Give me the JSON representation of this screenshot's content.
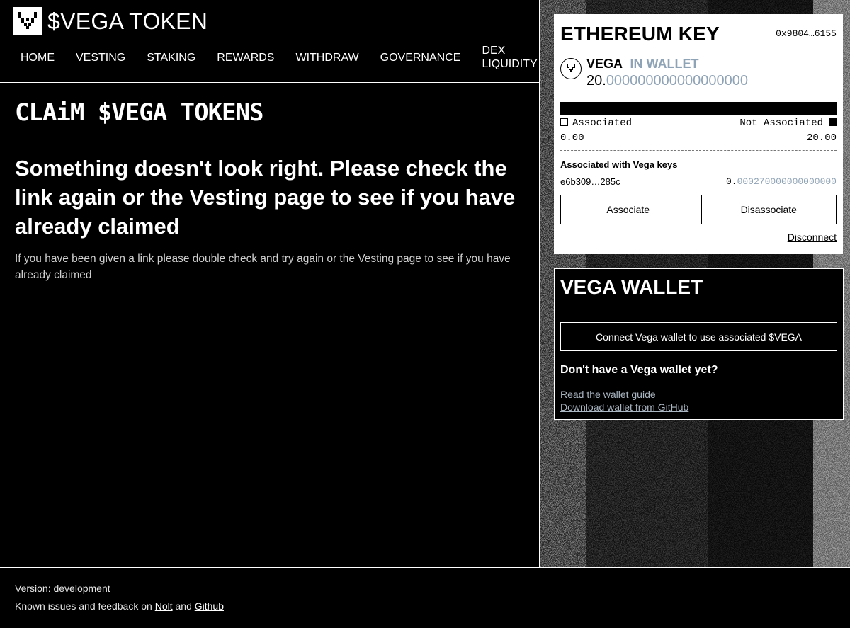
{
  "header": {
    "logo_icon": "vega-logo-icon",
    "title": "$VEGA TOKEN",
    "nav": [
      {
        "label": "HOME"
      },
      {
        "label": "VESTING"
      },
      {
        "label": "STAKING"
      },
      {
        "label": "REWARDS"
      },
      {
        "label": "WITHDRAW"
      },
      {
        "label": "GOVERNANCE"
      },
      {
        "label": "DEX LIQUIDITY"
      }
    ]
  },
  "main": {
    "page_title": "CLAiM $VEGA TOKENS",
    "headline": "Something doesn't look right. Please check the link again or the Vesting page to see if you have already claimed",
    "subtext": "If you have been given a link please double check and try again or the Vesting page to see if you have already claimed"
  },
  "ethereum": {
    "title": "ETHEREUM KEY",
    "address": "0x9804…6155",
    "token_name": "VEGA",
    "token_status": "IN WALLET",
    "amount_int": "20.",
    "amount_dec": "000000000000000000",
    "associated_label": "Associated",
    "not_associated_label": "Not Associated",
    "associated_value": "0.00",
    "not_associated_value": "20.00",
    "associated_keys_title": "Associated with Vega keys",
    "key_id": "e6b309…285c",
    "key_amount_int": "0.",
    "key_amount_dec": "000270000000000000",
    "associate_label": "Associate",
    "disassociate_label": "Disassociate",
    "disconnect_label": "Disconnect"
  },
  "vega_wallet": {
    "title": "VEGA WALLET",
    "connect_label": "Connect Vega wallet to use associated $VEGA",
    "question": "Don't have a Vega wallet yet?",
    "guide_link": "Read the wallet guide",
    "download_link": "Download wallet from GitHub"
  },
  "footer": {
    "version": "Version: development",
    "feedback_prefix": "Known issues and feedback on",
    "nolt": "Nolt",
    "and": "and",
    "github": "Github"
  },
  "colors": {
    "background": "#000000",
    "foreground": "#ffffff",
    "muted_blue": "#8fa3b6"
  }
}
